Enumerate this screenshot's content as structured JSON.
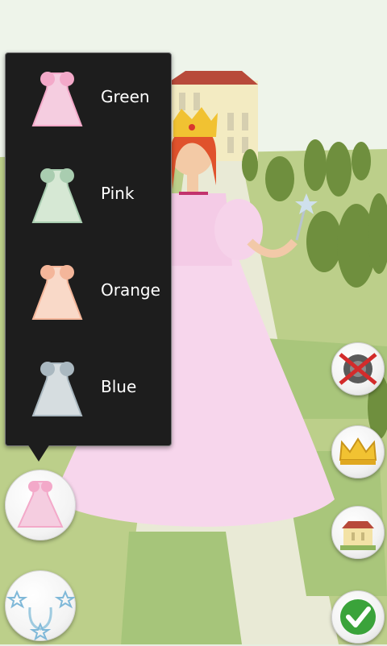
{
  "dress_menu": {
    "items": [
      {
        "label": "Green",
        "color": "#f5cde0",
        "trim": "#f3a9c9"
      },
      {
        "label": "Pink",
        "color": "#d6e8d4",
        "trim": "#a9cdb0"
      },
      {
        "label": "Orange",
        "color": "#f9d9c8",
        "trim": "#f4b69a"
      },
      {
        "label": "Blue",
        "color": "#d6dde0",
        "trim": "#aab8c0"
      }
    ]
  },
  "toolbar": {
    "mute_icon": "speaker-muted-icon",
    "crown_icon": "crown-icon",
    "background_icon": "palace-icon",
    "confirm_icon": "checkmark-icon",
    "dress_icon": "dress-icon",
    "decor_icon": "stars-wreath-icon"
  },
  "colors": {
    "popup_bg": "#1d1d1d",
    "gown": "#f7d6ec",
    "confirm_green": "#3aa33a"
  }
}
